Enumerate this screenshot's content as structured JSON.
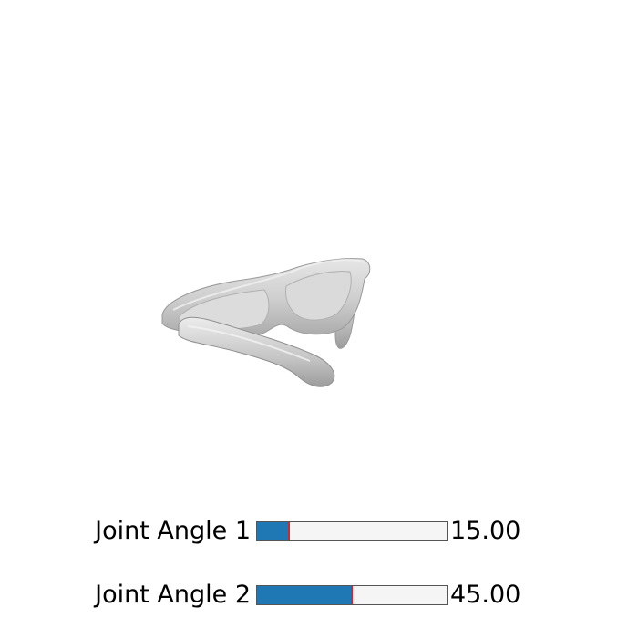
{
  "viewer": {
    "object_icon": "sunglasses-3d-model",
    "mesh_color": "#c8c8c8"
  },
  "sliders": [
    {
      "label": "Joint Angle 1",
      "value_text": "15.00",
      "value": 15.0,
      "min": 0,
      "max": 90,
      "fill_color": "#1f77b4",
      "handle_color": "#d62728"
    },
    {
      "label": "Joint Angle 2",
      "value_text": "45.00",
      "value": 45.0,
      "min": 0,
      "max": 90,
      "fill_color": "#1f77b4",
      "handle_color": "#d62728"
    }
  ]
}
